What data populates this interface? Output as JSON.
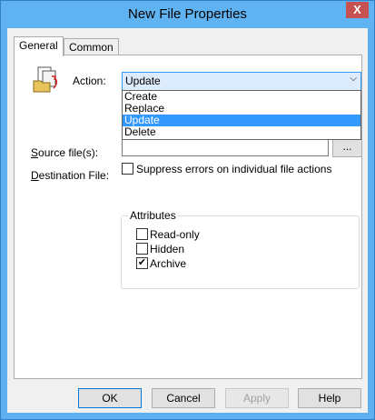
{
  "window": {
    "title": "New File Properties",
    "close_glyph": "X"
  },
  "tabs": [
    {
      "label": "General",
      "active": true
    },
    {
      "label": "Common",
      "active": false
    }
  ],
  "action": {
    "label": "Action:",
    "selected": "Update",
    "options": [
      "Create",
      "Replace",
      "Update",
      "Delete"
    ],
    "highlighted": "Update"
  },
  "source": {
    "label": "Source file(s):",
    "value": ""
  },
  "destination": {
    "label": "Destination File:",
    "value": "",
    "browse_label": "..."
  },
  "suppress": {
    "label": "Suppress errors on individual file actions",
    "checked": false
  },
  "attributes": {
    "title": "Attributes",
    "items": [
      {
        "label": "Read-only",
        "checked": false
      },
      {
        "label": "Hidden",
        "checked": false
      },
      {
        "label": "Archive",
        "checked": true
      }
    ]
  },
  "buttons": {
    "ok": "OK",
    "cancel": "Cancel",
    "apply": "Apply",
    "help": "Help"
  },
  "colors": {
    "titlebar": "#60b3f2",
    "close": "#c75050",
    "highlight": "#3399ff"
  },
  "icons": {
    "file_action": "file-copy-icon",
    "dropdown": "chevron-down-icon",
    "close": "close-icon",
    "check": "checkmark-icon"
  }
}
